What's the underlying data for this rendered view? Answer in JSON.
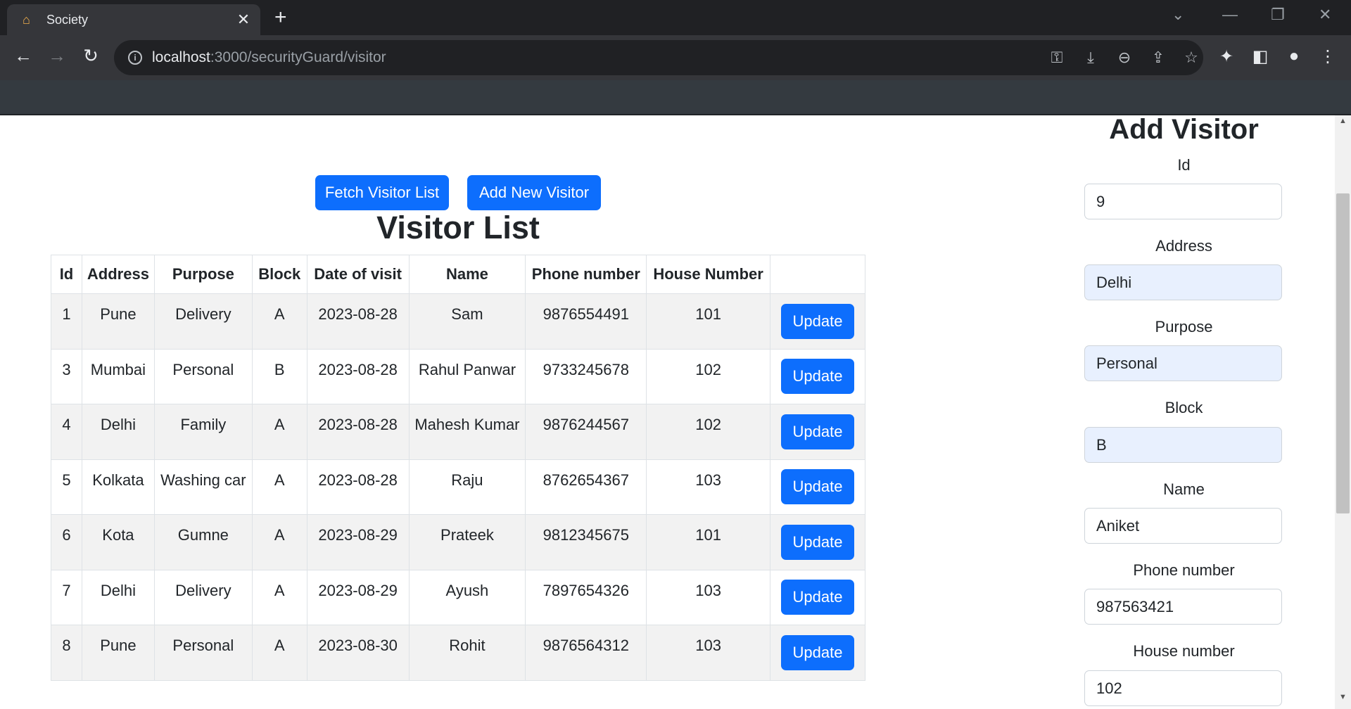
{
  "browser": {
    "tab_title": "Society",
    "url_host": "localhost",
    "url_path": ":3000/securityGuard/visitor"
  },
  "toolbar": {
    "fetch_label": "Fetch Visitor List",
    "add_label": "Add New Visitor"
  },
  "list": {
    "title": "Visitor List",
    "headers": [
      "Id",
      "Address",
      "Purpose",
      "Block",
      "Date of visit",
      "Name",
      "Phone number",
      "House Number"
    ],
    "update_label": "Update",
    "rows": [
      {
        "id": "1",
        "address": "Pune",
        "purpose": "Delivery",
        "block": "A",
        "date": "2023-08-28",
        "name": "Sam",
        "phone": "9876554491",
        "house": "101"
      },
      {
        "id": "3",
        "address": "Mumbai",
        "purpose": "Personal",
        "block": "B",
        "date": "2023-08-28",
        "name": "Rahul Panwar",
        "phone": "9733245678",
        "house": "102"
      },
      {
        "id": "4",
        "address": "Delhi",
        "purpose": "Family",
        "block": "A",
        "date": "2023-08-28",
        "name": "Mahesh Kumar",
        "phone": "9876244567",
        "house": "102"
      },
      {
        "id": "5",
        "address": "Kolkata",
        "purpose": "Washing car",
        "block": "A",
        "date": "2023-08-28",
        "name": "Raju",
        "phone": "8762654367",
        "house": "103"
      },
      {
        "id": "6",
        "address": "Kota",
        "purpose": "Gumne",
        "block": "A",
        "date": "2023-08-29",
        "name": "Prateek",
        "phone": "9812345675",
        "house": "101"
      },
      {
        "id": "7",
        "address": "Delhi",
        "purpose": "Delivery",
        "block": "A",
        "date": "2023-08-29",
        "name": "Ayush",
        "phone": "7897654326",
        "house": "103"
      },
      {
        "id": "8",
        "address": "Pune",
        "purpose": "Personal",
        "block": "A",
        "date": "2023-08-30",
        "name": "Rohit",
        "phone": "9876564312",
        "house": "103"
      }
    ]
  },
  "form": {
    "title": "Add Visitor",
    "fields": {
      "id": {
        "label": "Id",
        "value": "9"
      },
      "address": {
        "label": "Address",
        "value": "Delhi"
      },
      "purpose": {
        "label": "Purpose",
        "value": "Personal"
      },
      "block": {
        "label": "Block",
        "value": "B"
      },
      "name": {
        "label": "Name",
        "value": "Aniket"
      },
      "phone": {
        "label": "Phone number",
        "value": "987563421"
      },
      "house": {
        "label": "House number",
        "value": "102"
      }
    }
  },
  "colors": {
    "primary": "#0d6efd",
    "navbar": "#343a40",
    "autofill": "#e8f0fe"
  }
}
